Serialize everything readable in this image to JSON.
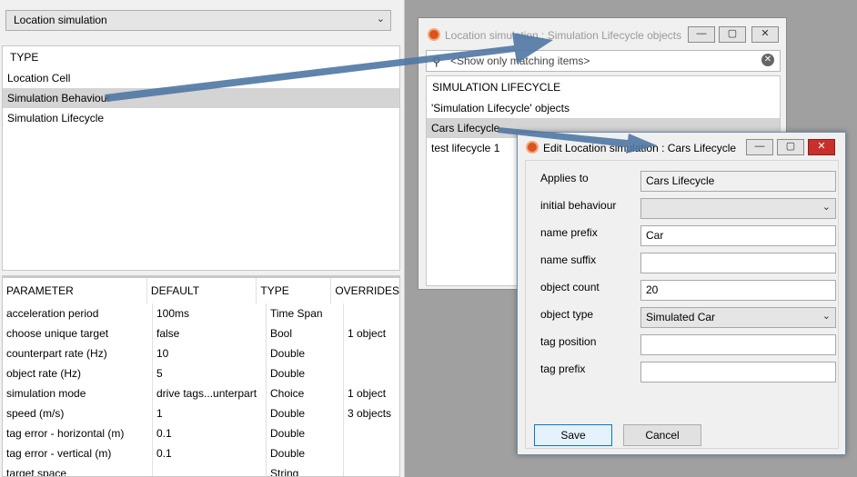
{
  "left": {
    "location_select": "Location simulation",
    "type_header": "TYPE",
    "types": [
      {
        "label": "Location Cell",
        "selected": false
      },
      {
        "label": "Simulation Behaviour",
        "selected": true
      },
      {
        "label": "Simulation Lifecycle",
        "selected": false
      }
    ],
    "param_headers": [
      "PARAMETER",
      "DEFAULT",
      "TYPE",
      "OVERRIDES"
    ],
    "params": [
      [
        "acceleration period",
        "100ms",
        "Time Span",
        ""
      ],
      [
        "choose unique target",
        "false",
        "Bool",
        "1 object"
      ],
      [
        "counterpart rate (Hz)",
        "10",
        "Double",
        ""
      ],
      [
        "object rate (Hz)",
        "5",
        "Double",
        ""
      ],
      [
        "simulation mode",
        "drive tags...unterpart",
        "Choice",
        "1 object"
      ],
      [
        "speed (m/s)",
        "1",
        "Double",
        "3 objects"
      ],
      [
        "tag error - horizontal (m)",
        "0.1",
        "Double",
        ""
      ],
      [
        "tag error - vertical (m)",
        "0.1",
        "Double",
        ""
      ],
      [
        "target space",
        "",
        "String",
        ""
      ]
    ]
  },
  "window1": {
    "title": "Location simulation : Simulation Lifecycle objects",
    "search_placeholder": "<Show only matching items>",
    "list_header": "SIMULATION LIFECYCLE",
    "items": [
      {
        "label": "'Simulation Lifecycle' objects",
        "selected": false
      },
      {
        "label": "Cars Lifecycle",
        "selected": true
      },
      {
        "label": "test lifecycle 1",
        "selected": false
      }
    ]
  },
  "window2": {
    "title": "Edit Location simulation : Cars Lifecycle",
    "fields": {
      "applies_to": {
        "label": "Applies to",
        "value": "Cars Lifecycle"
      },
      "initial_behaviour": {
        "label": "initial behaviour",
        "value": ""
      },
      "name_prefix": {
        "label": "name prefix",
        "value": "Car"
      },
      "name_suffix": {
        "label": "name suffix",
        "value": ""
      },
      "object_count": {
        "label": "object count",
        "value": "20"
      },
      "object_type": {
        "label": "object type",
        "value": "Simulated Car"
      },
      "tag_position": {
        "label": "tag position",
        "value": ""
      },
      "tag_prefix": {
        "label": "tag prefix",
        "value": ""
      }
    },
    "save_label": "Save",
    "cancel_label": "Cancel"
  },
  "icons": {
    "window_icon": "app-logo-icon",
    "minimize": "minimize-icon",
    "maximize": "maximize-icon",
    "close": "close-icon",
    "search": "search-icon",
    "clear": "clear-search-icon",
    "dropdown": "chevron-down-icon"
  },
  "colors": {
    "selection": "#d4d4d4",
    "arrow": "#4f77a3",
    "close_button": "#c9302c",
    "app_icon": "#d9541e"
  }
}
